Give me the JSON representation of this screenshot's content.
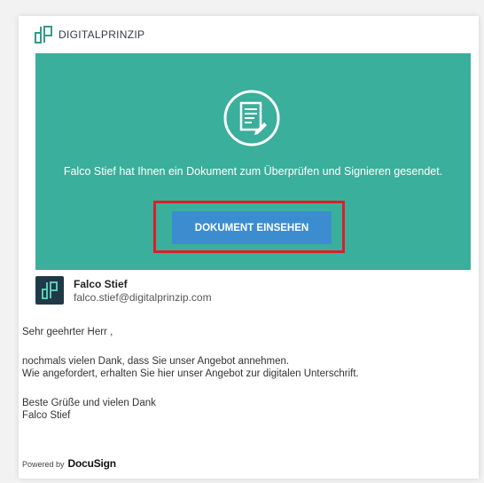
{
  "brand": {
    "name": "DIGITALPRINZIP",
    "logo_icon": "dp-logo-icon",
    "color": "#2f9c8a"
  },
  "hero": {
    "background_color": "#3aaf9b",
    "icon": "document-sign-icon",
    "message": "Falco Stief hat Ihnen ein Dokument zum Überprüfen und Signieren gesendet.",
    "button_label": "DOKUMENT EINSEHEN",
    "button_color": "#3b8dd0",
    "highlight_color": "#d9202a"
  },
  "sender": {
    "name": "Falco Stief",
    "email": "falco.stief@digitalprinzip.com",
    "avatar_icon": "dp-logo-icon"
  },
  "message": {
    "greeting": "Sehr geehrter Herr           ,",
    "line1": "nochmals vielen Dank, dass Sie unser Angebot annehmen.",
    "line2": "Wie angefordert, erhalten Sie hier unser Angebot zur digitalen Unterschrift.",
    "closing": "Beste Grüße und vielen Dank",
    "signature": "Falco Stief"
  },
  "footer": {
    "powered_by": "Powered by",
    "brand": "DocuSign"
  }
}
